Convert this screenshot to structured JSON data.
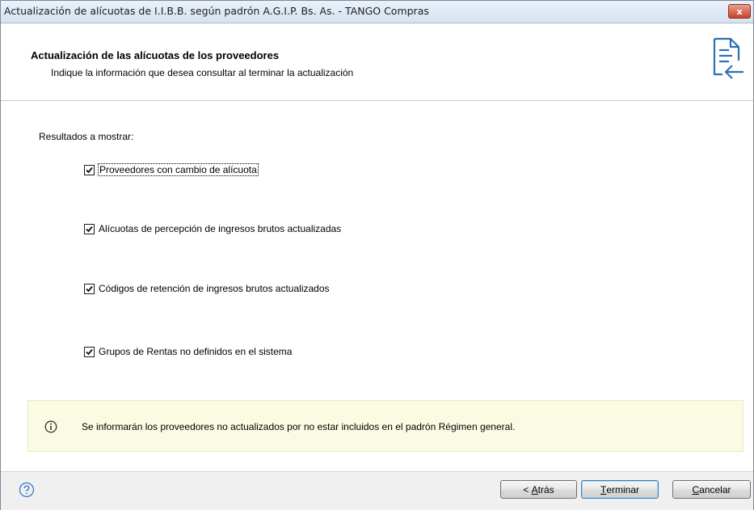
{
  "window": {
    "title": "Actualización de alícuotas de I.I.B.B. según padrón A.G.I.P. Bs. As. - TANGO Compras",
    "close_label": "x"
  },
  "header": {
    "title": "Actualización de las alícuotas de los proveedores",
    "subtitle": "Indique la información que desea consultar al terminar la actualización",
    "icon": "document-import-icon"
  },
  "main": {
    "results_label": "Resultados a mostrar:",
    "options": [
      {
        "label": "Proveedores con cambio de alícuota",
        "checked": true
      },
      {
        "label": "Alícuotas de percepción de ingresos brutos actualizadas",
        "checked": true
      },
      {
        "label": "Códigos de retención de ingresos brutos actualizados",
        "checked": true
      },
      {
        "label": "Grupos de Rentas no definidos en el sistema",
        "checked": true
      }
    ],
    "info": {
      "icon": "info-icon",
      "text": "Se informarán los proveedores no actualizados por no estar incluidos en el padrón Régimen general."
    }
  },
  "footer": {
    "help_icon": "help-icon",
    "back": {
      "mnemonic": "A",
      "rest": "trás",
      "prefix": "< "
    },
    "finish": {
      "mnemonic": "T",
      "rest": "erminar"
    },
    "cancel": {
      "mnemonic": "C",
      "rest": "ancelar"
    }
  },
  "colors": {
    "titlebar": "#d6e2f0",
    "close_button": "#c8412a",
    "info_background": "#fbfbe4",
    "icon_blue": "#2d6fb4"
  }
}
